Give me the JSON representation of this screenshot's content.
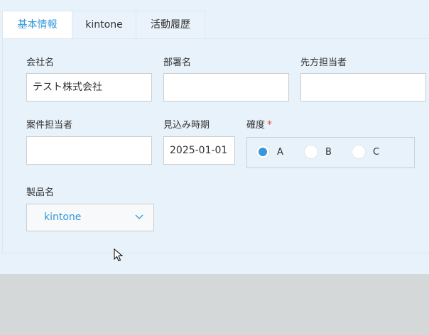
{
  "tabs": [
    {
      "label": "基本情報",
      "active": true
    },
    {
      "label": "kintone",
      "active": false
    },
    {
      "label": "活動履歴",
      "active": false
    }
  ],
  "fields": {
    "company": {
      "label": "会社名",
      "value": "テスト株式会社"
    },
    "department": {
      "label": "部署名",
      "value": ""
    },
    "counterpart": {
      "label": "先方担当者",
      "value": ""
    },
    "owner": {
      "label": "案件担当者",
      "value": ""
    },
    "expected_date": {
      "label": "見込み時期",
      "value": "2025-01-01"
    },
    "certainty": {
      "label": "確度",
      "required_mark": "*",
      "options": [
        "A",
        "B",
        "C"
      ],
      "selected": "A"
    },
    "product": {
      "label": "製品名",
      "value": "kintone"
    }
  },
  "colors": {
    "accent": "#3498db",
    "required": "#e74c3c",
    "panel_bg": "#e8f2fa",
    "outer_bg": "#d5d8d8"
  },
  "icons": {
    "dropdown": "chevron-down-icon",
    "cursor": "mouse-pointer-icon"
  }
}
